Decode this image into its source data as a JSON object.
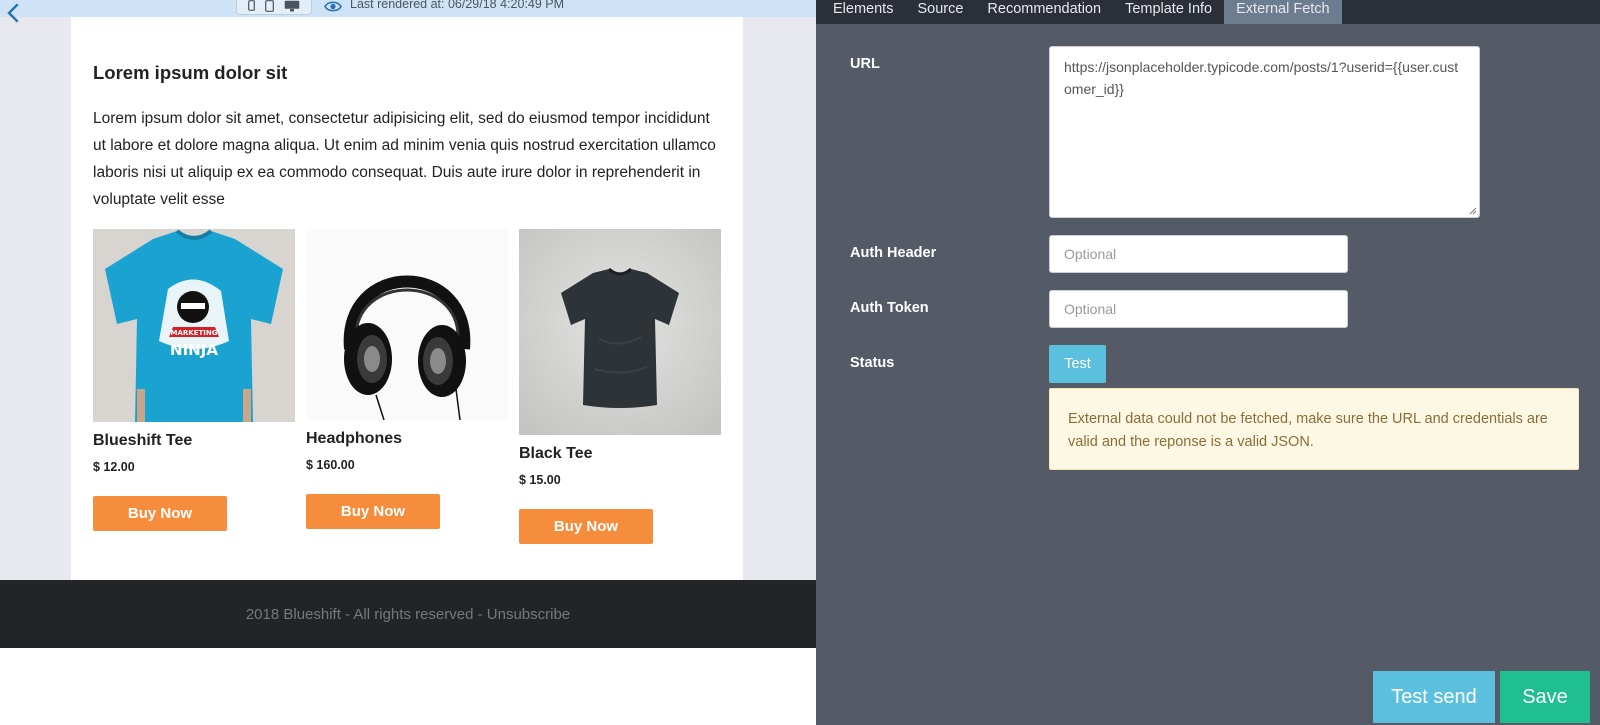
{
  "topbar": {
    "rendered": "Last rendered at: 06/29/18 4:20:49 PM"
  },
  "email": {
    "headline": "Lorem ipsum dolor sit",
    "body": "Lorem ipsum dolor sit amet, consectetur adipisicing elit, sed do eiusmod tempor incididunt ut labore et dolore magna aliqua. Ut enim ad minim venia quis nostrud exercitation ullamco laboris nisi ut aliquip ex ea commodo consequat. Duis aute irure dolor in reprehenderit in voluptate velit esse",
    "products": [
      {
        "name": "Blueshift Tee",
        "price": "$ 12.00",
        "button": "Buy Now",
        "image_icon": "blue-tshirt-image",
        "tee_print_1": "MARKETING",
        "tee_print_2": "NINJA"
      },
      {
        "name": "Headphones",
        "price": "$ 160.00",
        "button": "Buy Now",
        "image_icon": "headphones-image"
      },
      {
        "name": "Black Tee",
        "price": "$ 15.00",
        "button": "Buy Now",
        "image_icon": "black-tshirt-image"
      }
    ],
    "footer": "2018 Blueshift - All rights reserved - Unsubscribe"
  },
  "panel": {
    "tabs": [
      "Elements",
      "Source",
      "Recommendation",
      "Template Info",
      "External Fetch"
    ],
    "active_tab": "External Fetch",
    "url_label": "URL",
    "url_value": "https://jsonplaceholder.typicode.com/posts/1?userid={{user.customer_id}}",
    "auth_header_label": "Auth Header",
    "auth_header_placeholder": "Optional",
    "auth_token_label": "Auth Token",
    "auth_token_placeholder": "Optional",
    "status_label": "Status",
    "test_button": "Test",
    "alert": "External data could not be fetched, make sure the URL and credentials are valid and the reponse is a valid JSON.",
    "test_send_button": "Test send",
    "save_button": "Save"
  },
  "colors": {
    "accent_orange": "#f68d3d",
    "info_blue": "#5bc0de",
    "save_green": "#1fbf8f",
    "panel_bg": "#545b67",
    "tab_bar": "#2b2f38"
  }
}
